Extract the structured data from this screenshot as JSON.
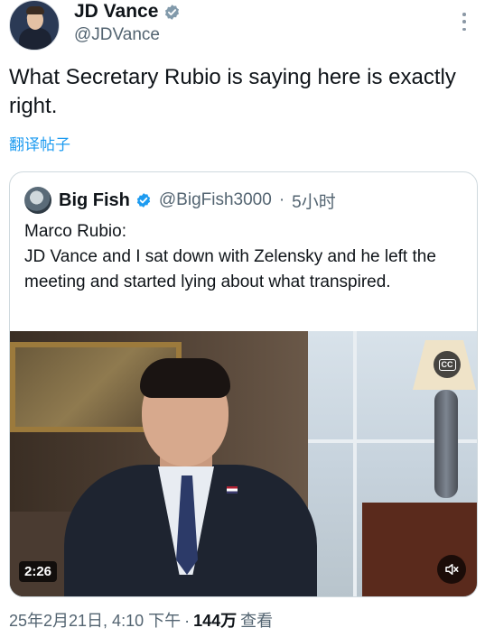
{
  "author": {
    "display_name": "JD Vance",
    "handle": "@JDVance",
    "verified_color": "#829aab"
  },
  "tweet": {
    "text": "What Secretary Rubio is saying here is exactly right.",
    "translate_label": "翻译帖子"
  },
  "quote": {
    "display_name": "Big Fish",
    "handle": "@BigFish3000",
    "separator": "·",
    "time_ago": "5小时",
    "verified_color": "#1d9bf0",
    "text_line1": "Marco Rubio:",
    "text_line2": "JD Vance and I sat down with Zelensky and he left the meeting and started lying about what transpired.",
    "video": {
      "duration": "2:26",
      "cc_label": "CC"
    }
  },
  "meta": {
    "date_time": "25年2月21日, 4:10 下午",
    "separator": "·",
    "views_count": "144万",
    "views_label": "查看"
  },
  "colors": {
    "link": "#1d9bf0",
    "secondary_text": "#536471",
    "primary_text": "#0f1419"
  }
}
